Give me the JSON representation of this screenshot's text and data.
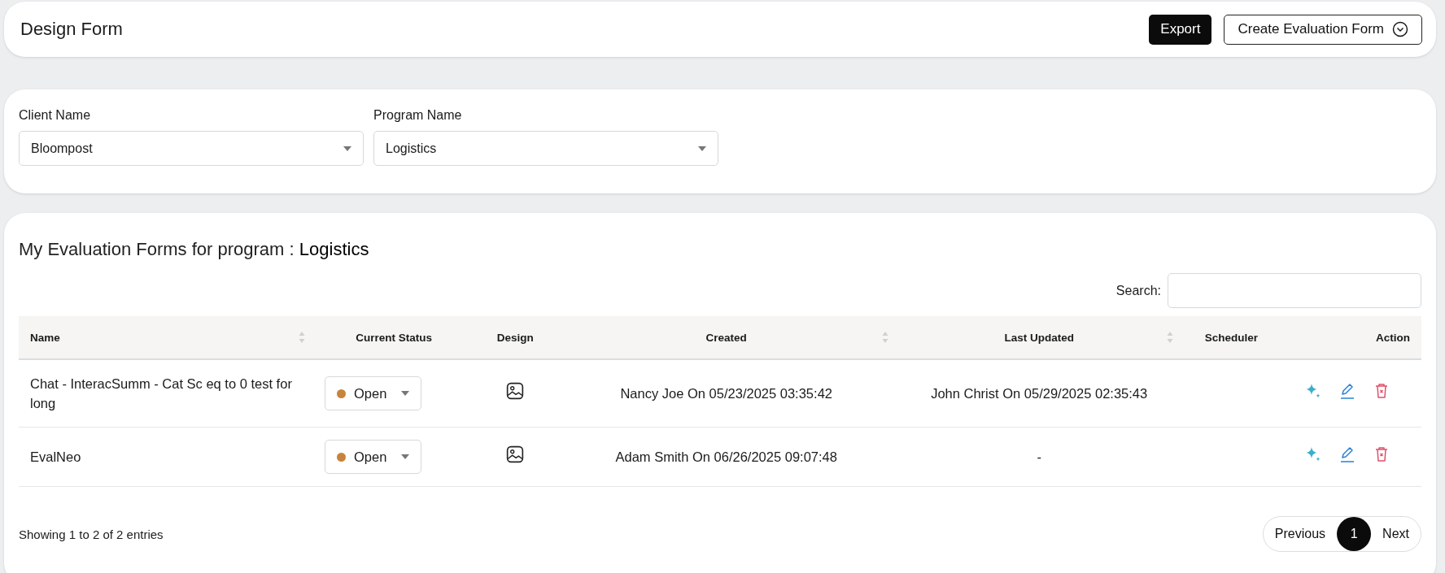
{
  "header": {
    "title": "Design Form",
    "buttons": [
      {
        "label": "Export",
        "kind": "primary"
      },
      {
        "label": "Create Evaluation Form",
        "kind": "dropdown"
      }
    ]
  },
  "filters": [
    {
      "label": "Client Name",
      "value": "Bloompost"
    },
    {
      "label": "Program Name",
      "value": "Logistics"
    }
  ],
  "forms": {
    "title_prefix": "My Evaluation Forms for program :",
    "program": "Logistics",
    "search": {
      "label": "Search:"
    },
    "table": {
      "columns": [
        {
          "label": "Name",
          "sortable": true
        },
        {
          "label": "Current Status",
          "sortable": false
        },
        {
          "label": "Design",
          "sortable": false
        },
        {
          "label": "Created",
          "sortable": true
        },
        {
          "label": "Last Updated",
          "sortable": true
        },
        {
          "label": "Scheduler",
          "sortable": false
        },
        {
          "label": "Action",
          "sortable": false
        }
      ],
      "rows": [
        {
          "name": "Chat - InteracSumm - Cat Sc eq to 0 test for long",
          "status": {
            "label": "Open",
            "color": "#c8843a"
          },
          "created": "Nancy Joe On 05/23/2025 03:35:42",
          "last_updated": "John Christ On 05/29/2025 02:35:43"
        },
        {
          "name": "EvalNeo",
          "status": {
            "label": "Open",
            "color": "#c8843a"
          },
          "created": "Adam Smith On 06/26/2025 09:07:48",
          "last_updated": "-"
        }
      ]
    },
    "info": "Showing 1 to 2 of 2 entries",
    "pagination": [
      {
        "label": "Previous",
        "selected": false
      },
      {
        "label": "1",
        "selected": true
      },
      {
        "label": "Next",
        "selected": false
      }
    ]
  }
}
